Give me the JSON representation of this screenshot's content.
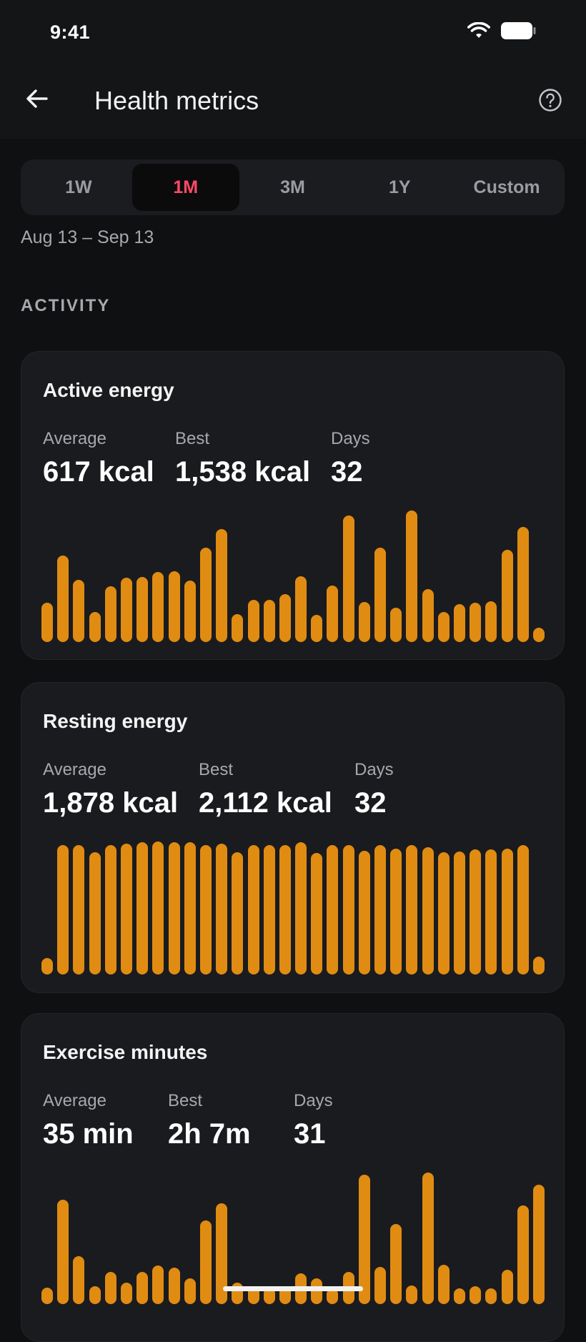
{
  "status_bar": {
    "time": "9:41"
  },
  "app_bar": {
    "title": "Health metrics"
  },
  "range": {
    "tabs": [
      "1W",
      "1M",
      "3M",
      "1Y",
      "Custom"
    ],
    "selected": "1M",
    "date_range": "Aug 13 – Sep 13"
  },
  "section": {
    "label": "ACTIVITY"
  },
  "colors": {
    "background": "#0f1012",
    "card": "#1a1b1e",
    "bar": "#e08c12",
    "active_tab_text": "#ff4a64"
  },
  "cards": [
    {
      "title": "Active energy",
      "stats": [
        {
          "label": "Average",
          "value": "617 kcal"
        },
        {
          "label": "Best",
          "value": "1,538 kcal"
        },
        {
          "label": "Days",
          "value": "32"
        }
      ],
      "chart_data": {
        "type": "bar",
        "unit": "kcal",
        "max": 1538,
        "values": [
          460,
          1010,
          730,
          350,
          650,
          750,
          760,
          820,
          830,
          720,
          1100,
          1320,
          330,
          490,
          490,
          560,
          770,
          320,
          660,
          1480,
          470,
          1100,
          400,
          1538,
          620,
          350,
          440,
          460,
          480,
          1080,
          1350,
          170
        ]
      }
    },
    {
      "title": "Resting energy",
      "stats": [
        {
          "label": "Average",
          "value": "1,878 kcal"
        },
        {
          "label": "Best",
          "value": "2,112 kcal"
        },
        {
          "label": "Days",
          "value": "32"
        }
      ],
      "chart_data": {
        "type": "bar",
        "unit": "kcal",
        "max": 2112,
        "values": [
          260,
          2050,
          2050,
          1940,
          2050,
          2080,
          2100,
          2112,
          2100,
          2100,
          2050,
          2080,
          1940,
          2050,
          2050,
          2050,
          2100,
          1930,
          2050,
          2050,
          1960,
          2050,
          2000,
          2050,
          2020,
          1940,
          1950,
          1990,
          1990,
          2000,
          2050,
          280
        ]
      }
    },
    {
      "title": "Exercise minutes",
      "stats": [
        {
          "label": "Average",
          "value": "35 min"
        },
        {
          "label": "Best",
          "value": "2h 7m"
        },
        {
          "label": "Days",
          "value": "31"
        }
      ],
      "chart_data": {
        "type": "bar",
        "unit": "min",
        "max": 127,
        "values": [
          16,
          101,
          46,
          17,
          31,
          21,
          31,
          37,
          35,
          25,
          81,
          97,
          21,
          17,
          16,
          17,
          30,
          25,
          15,
          31,
          125,
          36,
          77,
          18,
          127,
          38,
          15,
          17,
          15,
          33,
          95,
          115
        ]
      }
    }
  ]
}
